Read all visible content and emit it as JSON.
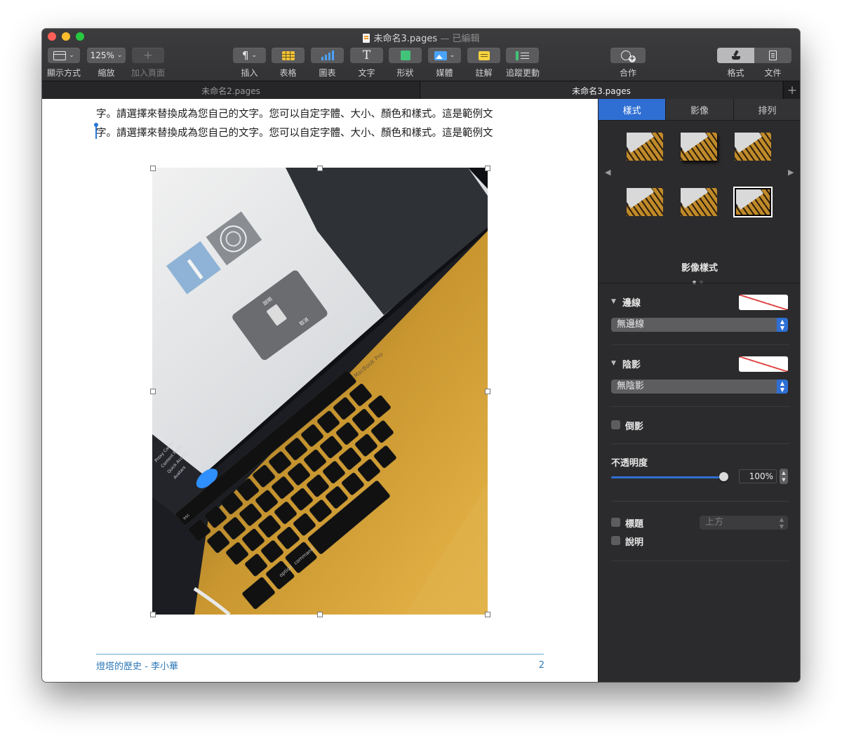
{
  "window": {
    "title": "未命名3.pages",
    "title_suffix": " — 已編輯"
  },
  "toolbar": {
    "view_label": "顯示方式",
    "zoom_value": "125%",
    "zoom_label": "縮放",
    "add_page_label": "加入頁面",
    "insert_label": "插入",
    "table_label": "表格",
    "chart_label": "圖表",
    "text_label": "文字",
    "shape_label": "形狀",
    "media_label": "媒體",
    "comment_label": "註解",
    "track_changes_label": "追蹤更動",
    "collaborate_label": "合作",
    "format_label": "格式",
    "document_label": "文件"
  },
  "tabs": [
    {
      "label": "未命名2.pages",
      "active": false
    },
    {
      "label": "未命名3.pages",
      "active": true
    }
  ],
  "document": {
    "lines": [
      "字。請選擇來替換成為您自己的文字。您可以自定字體、大小、顏色和樣式。這是範例文",
      "字。請選擇來替換成為您自己的文字。您可以自定字體、大小、顏色和樣式。這是範例文"
    ],
    "photo_text": {
      "dialog_title": "說明",
      "dialog_button": "取消",
      "sidebar_item_1": "Proxy Cache",
      "sidebar_item_2": "Content Party",
      "sidebar_item_3": "Quick Access",
      "sidebar_item_4": "Avatars",
      "brand": "MacBook Pro",
      "key_command": "command",
      "key_option": "option",
      "key_esc": "esc"
    },
    "footer_title": "燈塔的歷史 - 李小華",
    "footer_page": "2"
  },
  "inspector": {
    "tabs": [
      "樣式",
      "影像",
      "排列"
    ],
    "active_tab": "樣式",
    "styles_label": "影像樣式",
    "border_label": "邊線",
    "border_value": "無邊線",
    "shadow_label": "陰影",
    "shadow_value": "無陰影",
    "reflection_label": "倒影",
    "opacity_label": "不透明度",
    "opacity_value": "100%",
    "opacity_fraction": 1.0,
    "title_label": "標題",
    "title_position": "上方",
    "caption_label": "說明"
  },
  "colors": {
    "accent": "#2f6fd4",
    "footer_text": "#2f7ab8",
    "toolbar_bg": "#3a3a3c"
  }
}
